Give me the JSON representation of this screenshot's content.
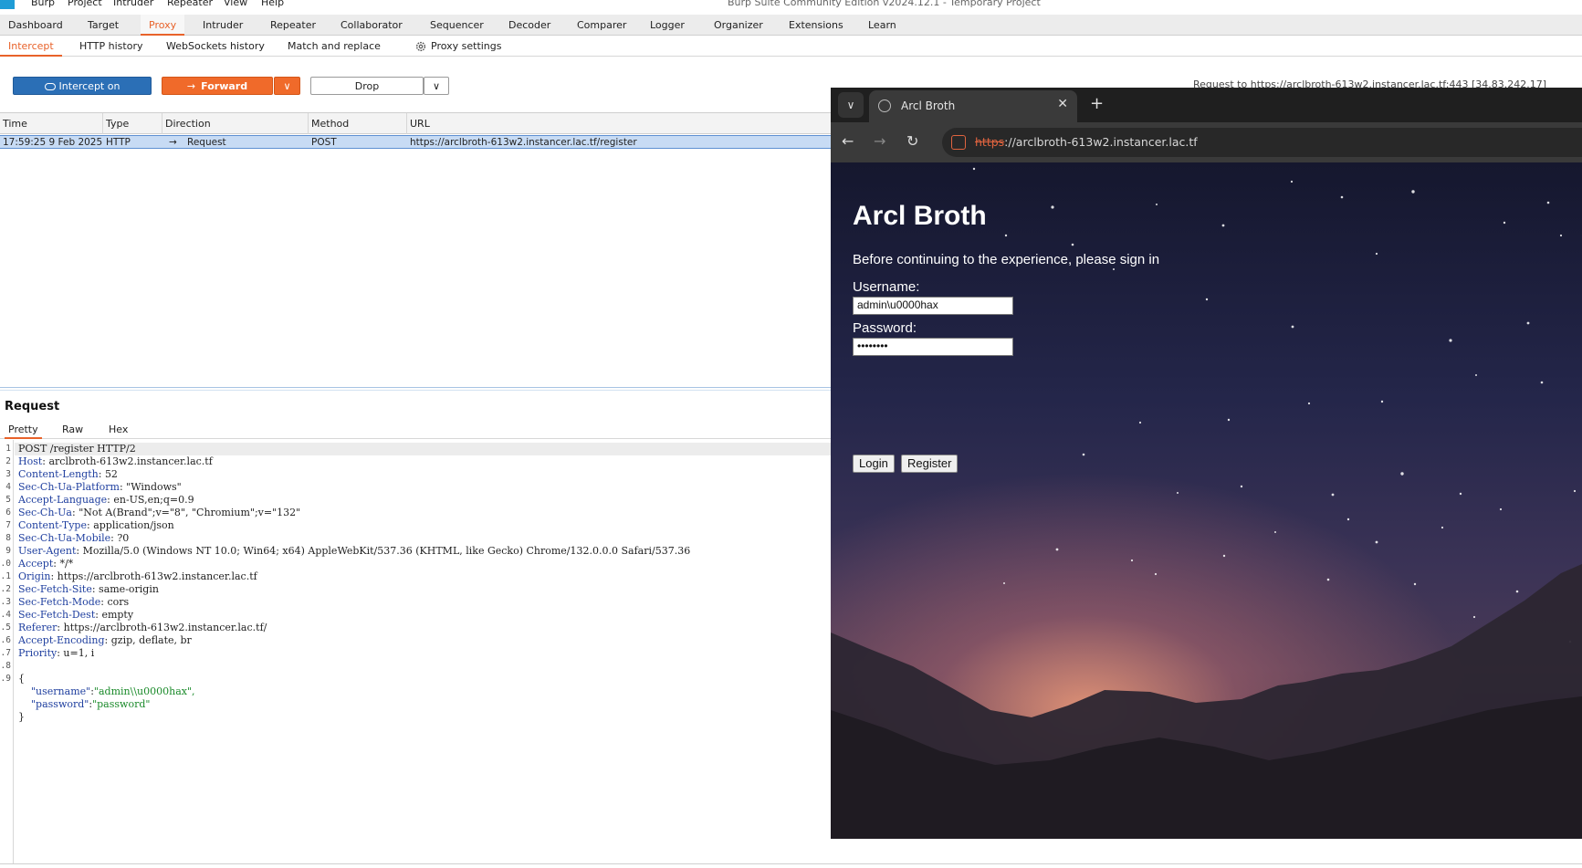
{
  "app": {
    "window_title": "Burp Suite Community Edition v2024.12.1 - Temporary Project",
    "menu": [
      "Burp",
      "Project",
      "Intruder",
      "Repeater",
      "View",
      "Help"
    ]
  },
  "main_tabs": [
    "Dashboard",
    "Target",
    "Proxy",
    "Intruder",
    "Repeater",
    "Collaborator",
    "Sequencer",
    "Decoder",
    "Comparer",
    "Logger",
    "Organizer",
    "Extensions",
    "Learn"
  ],
  "sub_tabs": [
    "Intercept",
    "HTTP history",
    "WebSockets history",
    "Match and replace"
  ],
  "proxy_settings_label": "Proxy settings",
  "toolbar": {
    "intercept_label": "Intercept on",
    "forward_label": "Forward",
    "drop_label": "Drop",
    "request_to": "Request to https://arclbroth-613w2.instancer.lac.tf:443 [34.83.242.17]"
  },
  "table": {
    "columns": [
      "Time",
      "Type",
      "Direction",
      "Method",
      "URL"
    ],
    "rows": [
      {
        "time": "17:59:25 9 Feb 2025",
        "type": "HTTP",
        "direction": "Request",
        "method": "POST",
        "url": "https://arclbroth-613w2.instancer.lac.tf/register"
      }
    ]
  },
  "request": {
    "title": "Request",
    "tabs": [
      "Pretty",
      "Raw",
      "Hex"
    ],
    "first_line": "POST /register HTTP/2",
    "headers": [
      {
        "k": "Host",
        "v": "arclbroth-613w2.instancer.lac.tf"
      },
      {
        "k": "Content-Length",
        "v": "52"
      },
      {
        "k": "Sec-Ch-Ua-Platform",
        "v": "\"Windows\""
      },
      {
        "k": "Accept-Language",
        "v": "en-US,en;q=0.9"
      },
      {
        "k": "Sec-Ch-Ua",
        "v": "\"Not A(Brand\";v=\"8\", \"Chromium\";v=\"132\""
      },
      {
        "k": "Content-Type",
        "v": "application/json"
      },
      {
        "k": "Sec-Ch-Ua-Mobile",
        "v": "?0"
      },
      {
        "k": "User-Agent",
        "v": "Mozilla/5.0 (Windows NT 10.0; Win64; x64) AppleWebKit/537.36 (KHTML, like Gecko) Chrome/132.0.0.0 Safari/537.36"
      },
      {
        "k": "Accept",
        "v": "*/*"
      },
      {
        "k": "Origin",
        "v": "https://arclbroth-613w2.instancer.lac.tf"
      },
      {
        "k": "Sec-Fetch-Site",
        "v": "same-origin"
      },
      {
        "k": "Sec-Fetch-Mode",
        "v": "cors"
      },
      {
        "k": "Sec-Fetch-Dest",
        "v": "empty"
      },
      {
        "k": "Referer",
        "v": "https://arclbroth-613w2.instancer.lac.tf/"
      },
      {
        "k": "Accept-Encoding",
        "v": "gzip, deflate, br"
      },
      {
        "k": "Priority",
        "v": "u=1, i"
      }
    ],
    "body_open": "{",
    "body_close": "}",
    "body": [
      {
        "k": "\"username\"",
        "v": "\"admin\\\\u0000hax\","
      },
      {
        "k": "\"password\"",
        "v": "\"password\""
      }
    ],
    "line_numbers": [
      "1",
      "2",
      "3",
      "4",
      "5",
      "6",
      "7",
      "8",
      "9",
      ".0",
      ".1",
      ".2",
      ".3",
      ".4",
      ".5",
      ".6",
      ".7",
      ".8",
      ".9"
    ]
  },
  "browser": {
    "tab_title": "Arcl Broth",
    "url_scheme": "https",
    "url_rest": "://arclbroth-613w2.instancer.lac.tf",
    "page": {
      "title": "Arcl Broth",
      "subtitle": "Before continuing to the experience, please sign in",
      "username_label": "Username:",
      "username_value": "admin\\u0000hax",
      "password_label": "Password:",
      "password_value": "••••••••",
      "login_label": "Login",
      "register_label": "Register"
    }
  },
  "icons": {
    "proxy_settings": "gear-icon",
    "intercept": "toggle-icon",
    "forward": "arrow-right-icon",
    "back": "back-arrow-icon",
    "forward_nav": "forward-arrow-icon",
    "reload": "reload-icon",
    "secure": "not-secure-icon",
    "tab_favicon": "globe-icon"
  },
  "colors": {
    "accent": "#e8622a",
    "intercept_button": "#2b6fb6",
    "forward_button": "#f06a2a",
    "selected_row": "#c7dbf4"
  }
}
